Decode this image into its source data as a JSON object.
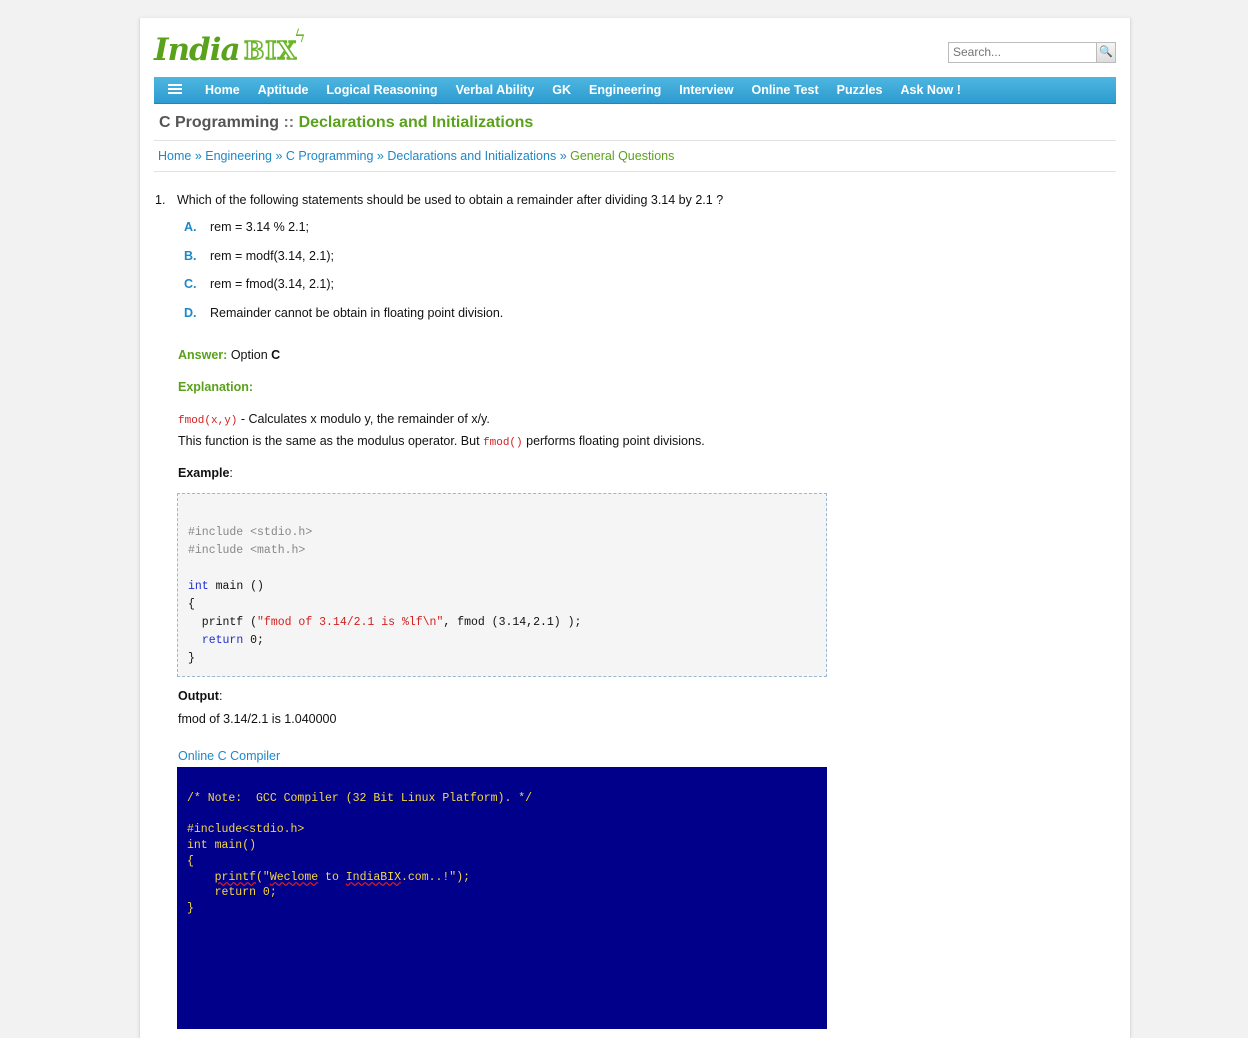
{
  "header": {
    "logo_main": "India",
    "logo_bix": "BIX",
    "search_placeholder": "Search..."
  },
  "nav": {
    "items": [
      "Home",
      "Aptitude",
      "Logical Reasoning",
      "Verbal Ability",
      "GK",
      "Engineering",
      "Interview",
      "Online Test",
      "Puzzles",
      "Ask Now !"
    ]
  },
  "heading": {
    "subject": "C Programming",
    "separator": " :: ",
    "topic": "Declarations and Initializations"
  },
  "breadcrumb": {
    "links": [
      "Home",
      "Engineering",
      "C Programming",
      "Declarations and Initializations"
    ],
    "separator": "»",
    "current": "General Questions"
  },
  "question": {
    "number": "1.",
    "text": "Which of the following statements should be used to obtain a remainder after dividing 3.14 by 2.1 ?",
    "options": [
      {
        "letter": "A.",
        "text": "rem = 3.14 % 2.1;"
      },
      {
        "letter": "B.",
        "text": "rem = modf(3.14, 2.1);"
      },
      {
        "letter": "C.",
        "text": "rem = fmod(3.14, 2.1);"
      },
      {
        "letter": "D.",
        "text": "Remainder cannot be obtain in floating point division."
      }
    ]
  },
  "answer": {
    "label": "Answer:",
    "prefix": "Option",
    "option": "C"
  },
  "explanation": {
    "label": "Explanation:",
    "func": "fmod(x,y)",
    "line1_rest": " - Calculates x modulo y, the remainder of x/y.",
    "line2_pre": "This function is the same as the modulus operator. But ",
    "line2_code": "fmod()",
    "line2_post": " performs floating point divisions."
  },
  "example": {
    "label": "Example",
    "colon": ":",
    "inc1": "#include <stdio.h>",
    "inc2": "#include <math.h>",
    "kw_int": "int",
    "main_rest": " main ()",
    "open": "{",
    "printf_pre": "  printf (",
    "printf_str": "\"fmod of 3.14/2.1 is %lf\\n\"",
    "printf_post": ", fmod (3.14,2.1) );",
    "ret_indent": "  ",
    "kw_return": "return",
    "ret_rest": " 0;",
    "close": "}"
  },
  "output": {
    "label": "Output",
    "colon": ":",
    "value": "fmod of 3.14/2.1 is 1.040000"
  },
  "compiler": {
    "link": "Online C Compiler",
    "line1": "/* Note:  GCC Compiler (32 Bit Linux Platform). */",
    "line2": "#include<stdio.h>",
    "line3": "int main()",
    "line4": "{",
    "line5_indent": "    ",
    "line5_printf": "printf",
    "line5_a": "(\"",
    "line5_weclome": "Weclome",
    "line5_b": " to ",
    "line5_site": "IndiaBIX",
    "line5_c": ".com..!\");",
    "line6": "    return 0;",
    "line7": "}"
  },
  "colors": {
    "nav_bg": "#2d9cd0",
    "green": "#5aa21c",
    "link_blue": "#1e88c8",
    "compiler_bg": "#00008b",
    "compiler_text": "#f5d742"
  }
}
